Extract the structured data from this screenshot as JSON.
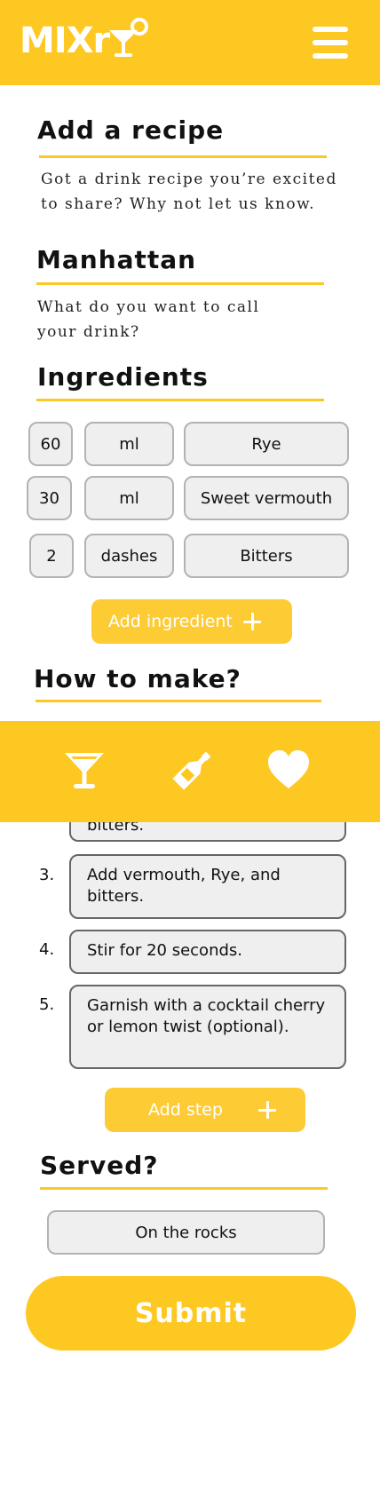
{
  "header": {
    "logo_text": "MIXr"
  },
  "intro": {
    "title": "Add a recipe",
    "description": "Got a drink recipe you’re excited to share? Why not let us know."
  },
  "drink": {
    "name": "Manhattan",
    "hint": "What do you want to call your drink?"
  },
  "ingredients": {
    "title": "Ingredients",
    "rows": [
      {
        "amount": "60",
        "unit": "ml",
        "name": "Rye"
      },
      {
        "amount": "30",
        "unit": "ml",
        "name": "Sweet vermouth"
      },
      {
        "amount": "2",
        "unit": "dashes",
        "name": "Bitters"
      }
    ],
    "add_label": "Add ingredient"
  },
  "method": {
    "title": "How to make?",
    "partial_step_text": "bitters.",
    "steps": [
      {
        "num": "3.",
        "text": "Add vermouth, Rye, and bitters."
      },
      {
        "num": "4.",
        "text": "Stir for 20 seconds."
      },
      {
        "num": "5.",
        "text": "Garnish with a cocktail cherry or lemon twist (optional)."
      }
    ],
    "add_label": "Add step"
  },
  "served": {
    "title": "Served?",
    "value": "On the rocks"
  },
  "submit_label": "Submit",
  "colors": {
    "accent": "#fec823",
    "pill_bg": "#efefef",
    "white": "#ffffff"
  }
}
